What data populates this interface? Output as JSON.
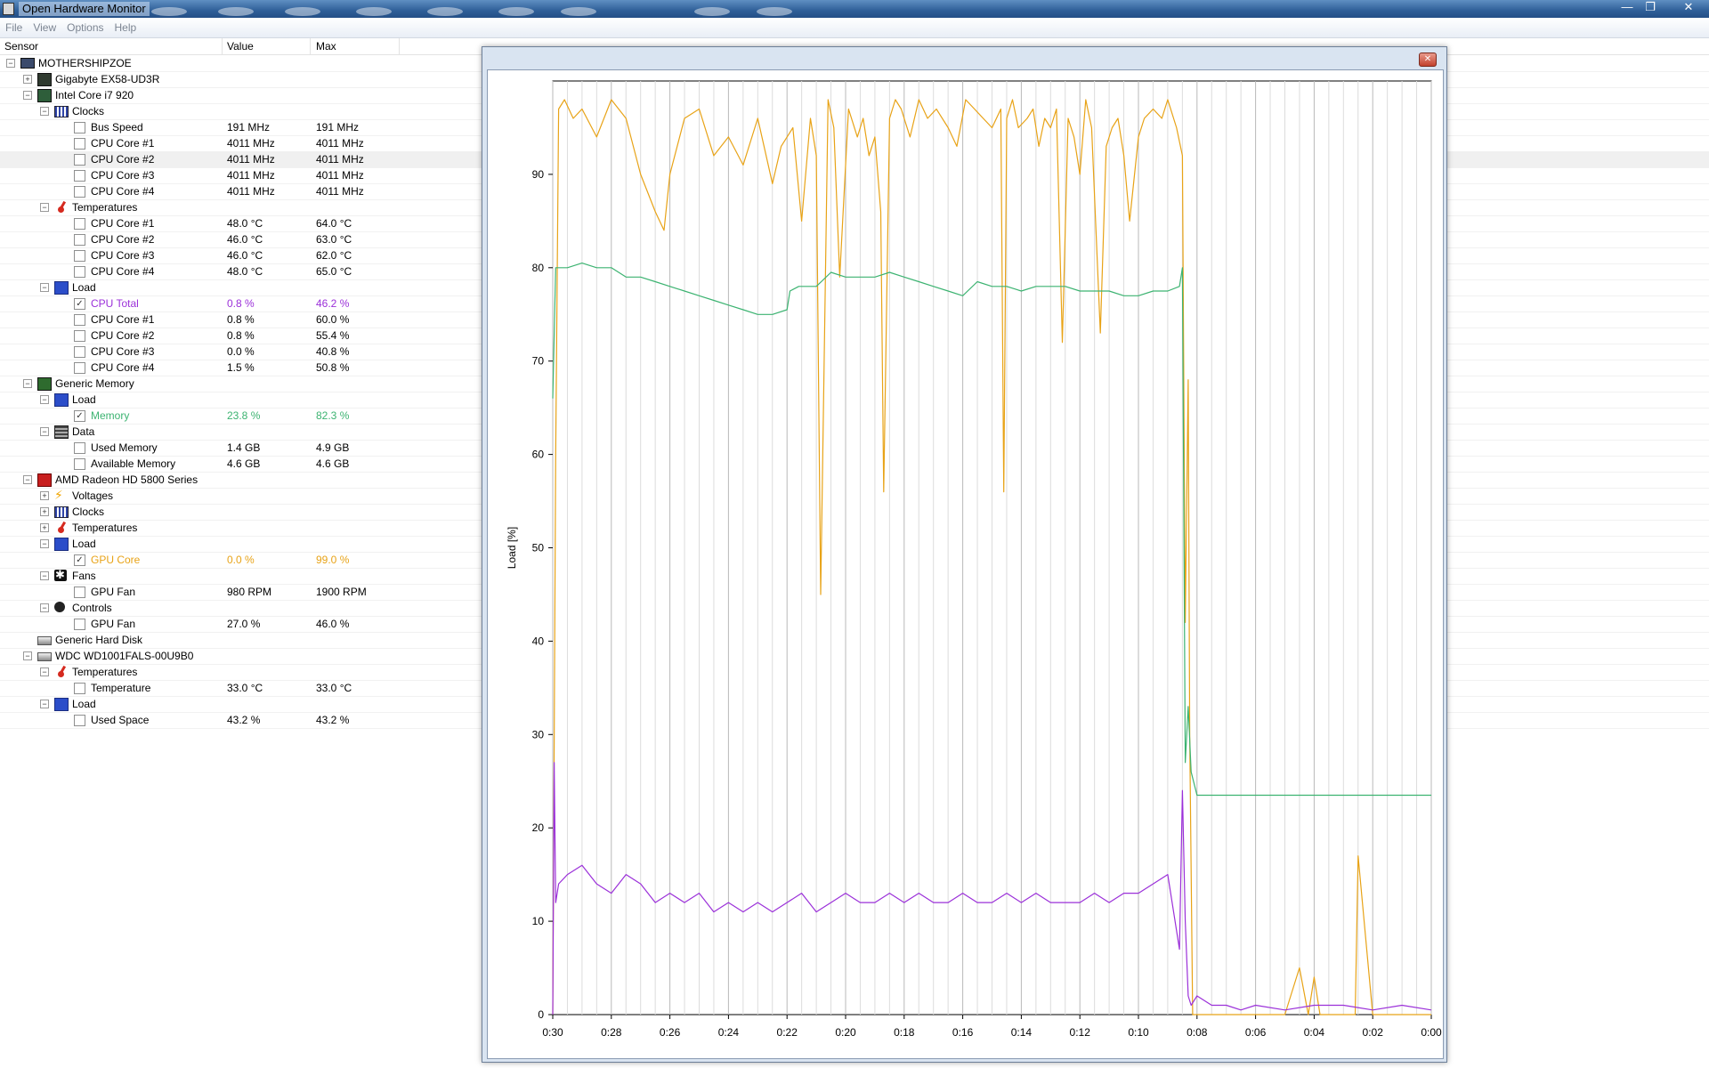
{
  "window": {
    "title": "Open Hardware Monitor",
    "minimize_glyph": "—",
    "maximize_glyph": "❐",
    "close_glyph": "✕"
  },
  "menu": [
    "File",
    "View",
    "Options",
    "Help"
  ],
  "columns": {
    "sensor": "Sensor",
    "value": "Value",
    "max": "Max"
  },
  "tree": [
    {
      "level": 0,
      "expander": "−",
      "icon": "computer",
      "label": "MOTHERSHIPZOE"
    },
    {
      "level": 1,
      "expander": "+",
      "icon": "board",
      "label": "Gigabyte EX58-UD3R"
    },
    {
      "level": 1,
      "expander": "−",
      "icon": "cpu",
      "label": "Intel Core i7 920"
    },
    {
      "level": 2,
      "expander": "−",
      "icon": "clock",
      "label": "Clocks"
    },
    {
      "level": 3,
      "checkbox": false,
      "label": "Bus Speed",
      "value": "191 MHz",
      "max": "191 MHz"
    },
    {
      "level": 3,
      "checkbox": false,
      "label": "CPU Core #1",
      "value": "4011 MHz",
      "max": "4011 MHz"
    },
    {
      "level": 3,
      "checkbox": false,
      "label": "CPU Core #2",
      "value": "4011 MHz",
      "max": "4011 MHz",
      "highlight": true
    },
    {
      "level": 3,
      "checkbox": false,
      "label": "CPU Core #3",
      "value": "4011 MHz",
      "max": "4011 MHz"
    },
    {
      "level": 3,
      "checkbox": false,
      "label": "CPU Core #4",
      "value": "4011 MHz",
      "max": "4011 MHz"
    },
    {
      "level": 2,
      "expander": "−",
      "icon": "temp",
      "label": "Temperatures"
    },
    {
      "level": 3,
      "checkbox": false,
      "label": "CPU Core #1",
      "value": "48.0 °C",
      "max": "64.0 °C"
    },
    {
      "level": 3,
      "checkbox": false,
      "label": "CPU Core #2",
      "value": "46.0 °C",
      "max": "63.0 °C"
    },
    {
      "level": 3,
      "checkbox": false,
      "label": "CPU Core #3",
      "value": "46.0 °C",
      "max": "62.0 °C"
    },
    {
      "level": 3,
      "checkbox": false,
      "label": "CPU Core #4",
      "value": "48.0 °C",
      "max": "65.0 °C"
    },
    {
      "level": 2,
      "expander": "−",
      "icon": "load",
      "label": "Load"
    },
    {
      "level": 3,
      "checkbox": true,
      "label": "CPU Total",
      "value": "0.8 %",
      "max": "46.2 %",
      "color": "#9b30d9"
    },
    {
      "level": 3,
      "checkbox": false,
      "label": "CPU Core #1",
      "value": "0.8 %",
      "max": "60.0 %"
    },
    {
      "level": 3,
      "checkbox": false,
      "label": "CPU Core #2",
      "value": "0.8 %",
      "max": "55.4 %"
    },
    {
      "level": 3,
      "checkbox": false,
      "label": "CPU Core #3",
      "value": "0.0 %",
      "max": "40.8 %"
    },
    {
      "level": 3,
      "checkbox": false,
      "label": "CPU Core #4",
      "value": "1.5 %",
      "max": "50.8 %"
    },
    {
      "level": 1,
      "expander": "−",
      "icon": "mem",
      "label": "Generic Memory"
    },
    {
      "level": 2,
      "expander": "−",
      "icon": "load",
      "label": "Load"
    },
    {
      "level": 3,
      "checkbox": true,
      "label": "Memory",
      "value": "23.8 %",
      "max": "82.3 %",
      "color": "#3cb371"
    },
    {
      "level": 2,
      "expander": "−",
      "icon": "data",
      "label": "Data"
    },
    {
      "level": 3,
      "checkbox": false,
      "label": "Used Memory",
      "value": "1.4 GB",
      "max": "4.9 GB"
    },
    {
      "level": 3,
      "checkbox": false,
      "label": "Available Memory",
      "value": "4.6 GB",
      "max": "4.6 GB"
    },
    {
      "level": 1,
      "expander": "−",
      "icon": "ati",
      "label": "AMD Radeon HD 5800 Series"
    },
    {
      "level": 2,
      "expander": "+",
      "icon": "volt",
      "label": "Voltages"
    },
    {
      "level": 2,
      "expander": "+",
      "icon": "clock",
      "label": "Clocks"
    },
    {
      "level": 2,
      "expander": "+",
      "icon": "temp",
      "label": "Temperatures"
    },
    {
      "level": 2,
      "expander": "−",
      "icon": "load",
      "label": "Load"
    },
    {
      "level": 3,
      "checkbox": true,
      "label": "GPU Core",
      "value": "0.0 %",
      "max": "99.0 %",
      "color": "#e8a317"
    },
    {
      "level": 2,
      "expander": "−",
      "icon": "fan",
      "label": "Fans"
    },
    {
      "level": 3,
      "checkbox": false,
      "label": "GPU Fan",
      "value": "980 RPM",
      "max": "1900 RPM"
    },
    {
      "level": 2,
      "expander": "−",
      "icon": "ctrl",
      "label": "Controls"
    },
    {
      "level": 3,
      "checkbox": false,
      "label": "GPU Fan",
      "value": "27.0 %",
      "max": "46.0 %"
    },
    {
      "level": 1,
      "icon": "disk",
      "label": "Generic Hard Disk"
    },
    {
      "level": 1,
      "expander": "−",
      "icon": "disk",
      "label": "WDC WD1001FALS-00U9B0"
    },
    {
      "level": 2,
      "expander": "−",
      "icon": "temp",
      "label": "Temperatures"
    },
    {
      "level": 3,
      "checkbox": false,
      "label": "Temperature",
      "value": "33.0 °C",
      "max": "33.0 °C"
    },
    {
      "level": 2,
      "expander": "−",
      "icon": "load",
      "label": "Load"
    },
    {
      "level": 3,
      "checkbox": false,
      "label": "Used Space",
      "value": "43.2 %",
      "max": "43.2 %"
    }
  ],
  "plot_window": {
    "close_glyph": "✕"
  },
  "chart_data": {
    "type": "line",
    "ylabel": "Load [%]",
    "ylim": [
      0,
      100
    ],
    "yticks": [
      0,
      10,
      20,
      30,
      40,
      50,
      60,
      70,
      80,
      90
    ],
    "xlim_minutes": [
      30,
      0
    ],
    "x_tick_labels": [
      "0:30",
      "0:28",
      "0:26",
      "0:24",
      "0:22",
      "0:20",
      "0:18",
      "0:16",
      "0:14",
      "0:12",
      "0:10",
      "0:08",
      "0:06",
      "0:04",
      "0:02",
      "0:00"
    ],
    "grid": "vertical every 0.5 min",
    "series": [
      {
        "name": "GPU Core",
        "color": "#e8a317",
        "x": [
          30,
          29.9,
          29.8,
          29.6,
          29.3,
          29.0,
          28.5,
          28.0,
          27.5,
          27.0,
          26.5,
          26.2,
          26.0,
          25.5,
          25.0,
          24.5,
          24.0,
          23.5,
          23.0,
          22.5,
          22.2,
          21.8,
          21.5,
          21.2,
          21.0,
          20.85,
          20.6,
          20.4,
          20.2,
          19.9,
          19.6,
          19.4,
          19.2,
          19.0,
          18.8,
          18.7,
          18.5,
          18.3,
          18.1,
          18.0,
          17.8,
          17.5,
          17.2,
          16.9,
          16.5,
          16.2,
          15.9,
          15.6,
          15.3,
          15.0,
          14.7,
          14.6,
          14.5,
          14.3,
          14.1,
          13.8,
          13.6,
          13.4,
          13.2,
          13.0,
          12.8,
          12.6,
          12.4,
          12.2,
          12.0,
          11.8,
          11.6,
          11.3,
          11.1,
          10.9,
          10.7,
          10.5,
          10.3,
          10.0,
          9.8,
          9.5,
          9.2,
          9.0,
          8.7,
          8.5,
          8.4,
          8.3,
          8.25,
          8.15,
          8.0,
          7.5,
          7.0,
          6.5,
          6.0,
          5.5,
          5.0,
          4.5,
          4.2,
          4.0,
          3.8,
          3.5,
          3.0,
          2.6,
          2.5,
          2.0,
          1.5,
          1.0,
          0.5,
          0.0
        ],
        "y": [
          0,
          60,
          97,
          98,
          96,
          97,
          94,
          98,
          96,
          90,
          86,
          84,
          90,
          96,
          97,
          92,
          94,
          91,
          96,
          89,
          93,
          95,
          85,
          96,
          92,
          45,
          98,
          95,
          79,
          97,
          94,
          96,
          92,
          94,
          86,
          56,
          96,
          98,
          97,
          96,
          94,
          98,
          96,
          97,
          95,
          93,
          98,
          97,
          96,
          95,
          97,
          56,
          96,
          98,
          95,
          96,
          97,
          93,
          96,
          95,
          97,
          72,
          96,
          94,
          90,
          98,
          95,
          73,
          93,
          95,
          96,
          92,
          85,
          94,
          96,
          97,
          96,
          98,
          95,
          92,
          42,
          68,
          30,
          0,
          0,
          0,
          0,
          0,
          0,
          0,
          0,
          5,
          0,
          4,
          0,
          0,
          0,
          0,
          17,
          0,
          0,
          0,
          0,
          0
        ]
      },
      {
        "name": "Memory",
        "color": "#3cb371",
        "x": [
          30,
          29.9,
          29.8,
          29.5,
          29.0,
          28.5,
          28.0,
          27.5,
          27.0,
          26.5,
          26.0,
          25.5,
          25.0,
          24.5,
          24.0,
          23.5,
          23.0,
          22.5,
          22.0,
          21.9,
          21.6,
          21.0,
          20.5,
          20.0,
          19.5,
          19.0,
          18.5,
          18.0,
          17.5,
          17.0,
          16.5,
          16.0,
          15.5,
          15.0,
          14.5,
          14.0,
          13.5,
          13.0,
          12.5,
          12.0,
          11.5,
          11.0,
          10.5,
          10.0,
          9.5,
          9.0,
          8.6,
          8.5,
          8.4,
          8.3,
          8.2,
          8.0,
          7.5,
          7.0,
          6.0,
          5.0,
          4.0,
          3.0,
          2.0,
          1.0,
          0.0
        ],
        "y": [
          66,
          80,
          80,
          80,
          80.5,
          80,
          80,
          79,
          79,
          78.5,
          78,
          77.5,
          77,
          76.5,
          76,
          75.5,
          75,
          75,
          75.5,
          77.5,
          78,
          78,
          79.5,
          79,
          79,
          79,
          79.5,
          79,
          78.5,
          78,
          77.5,
          77,
          78.5,
          78,
          78,
          77.5,
          78,
          78,
          78,
          77.5,
          77.5,
          77.5,
          77,
          77,
          77.5,
          77.5,
          78,
          80,
          27,
          33,
          26,
          23.5,
          23.5,
          23.5,
          23.5,
          23.5,
          23.5,
          23.5,
          23.5,
          23.5,
          23.5
        ]
      },
      {
        "name": "CPU Total",
        "color": "#9b30d9",
        "x": [
          30,
          29.95,
          29.9,
          29.8,
          29.5,
          29.0,
          28.5,
          28.0,
          27.5,
          27.0,
          26.5,
          26.0,
          25.5,
          25.0,
          24.5,
          24.0,
          23.5,
          23.0,
          22.5,
          22.0,
          21.5,
          21.0,
          20.5,
          20.0,
          19.5,
          19.0,
          18.5,
          18.0,
          17.5,
          17.0,
          16.5,
          16.0,
          15.5,
          15.0,
          14.5,
          14.0,
          13.5,
          13.0,
          12.5,
          12.0,
          11.5,
          11.0,
          10.5,
          10.0,
          9.5,
          9.0,
          8.6,
          8.5,
          8.4,
          8.3,
          8.2,
          8.0,
          7.5,
          7.0,
          6.5,
          6.0,
          5.0,
          4.0,
          3.0,
          2.0,
          1.0,
          0.0
        ],
        "y": [
          0,
          27,
          12,
          14,
          15,
          16,
          14,
          13,
          15,
          14,
          12,
          13,
          12,
          13,
          11,
          12,
          11,
          12,
          11,
          12,
          13,
          11,
          12,
          13,
          12,
          12,
          13,
          12,
          13,
          12,
          12,
          13,
          12,
          12,
          13,
          12,
          13,
          12,
          12,
          12,
          13,
          12,
          13,
          13,
          14,
          15,
          7,
          24,
          10,
          2,
          1,
          2,
          1,
          1,
          0.5,
          1,
          0.5,
          1,
          1,
          0.5,
          1,
          0.5
        ]
      }
    ]
  }
}
